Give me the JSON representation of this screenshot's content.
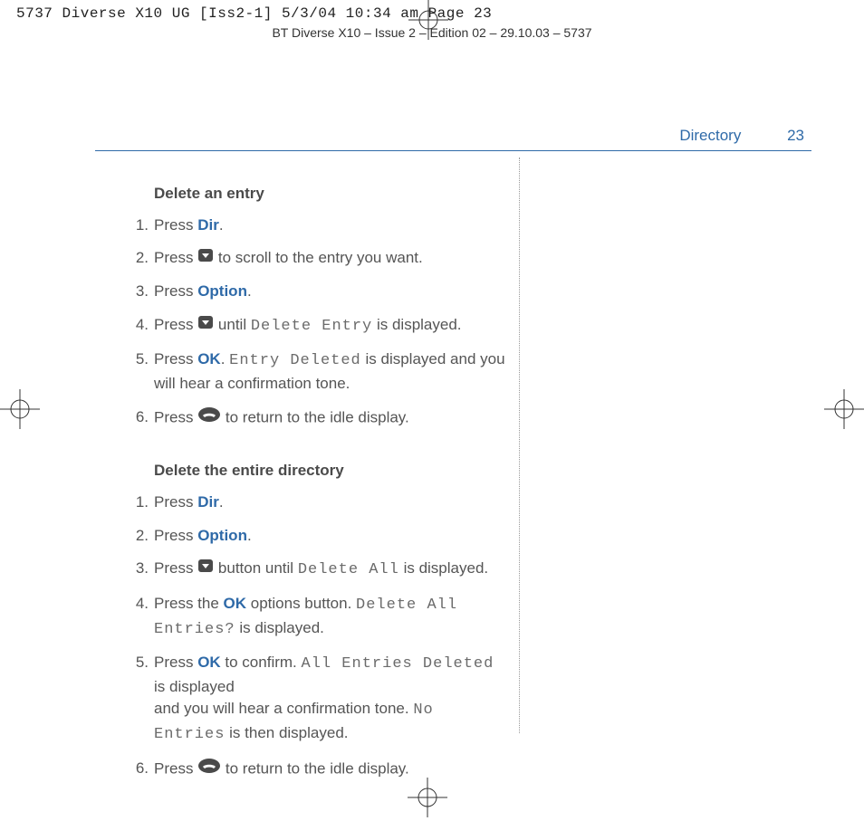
{
  "preflight": "5737 Diverse X10 UG [Iss2-1]  5/3/04  10:34 am  Page 23",
  "issue_line": "BT Diverse X10 – Issue 2 – Edition 02 – 29.10.03 – 5737",
  "running_head": {
    "section": "Directory",
    "page": "23"
  },
  "section1": {
    "title": "Delete an entry",
    "steps": [
      {
        "n": "1.",
        "pre": "Press ",
        "key": "Dir",
        "post": "."
      },
      {
        "n": "2.",
        "pre": "Press ",
        "icon": "down",
        "post": " to scroll to the entry you want."
      },
      {
        "n": "3.",
        "pre": "Press ",
        "key": "Option",
        "post": "."
      },
      {
        "n": "4.",
        "pre": "Press ",
        "icon": "down",
        "mid": " until ",
        "lcd": "Delete Entry",
        "post": " is displayed."
      },
      {
        "n": "5.",
        "pre": "Press ",
        "key": "OK",
        "mid": ". ",
        "lcd": "Entry Deleted",
        "post": " is displayed and you will hear a confirmation tone."
      },
      {
        "n": "6.",
        "pre": "Press ",
        "icon": "end",
        "post": " to return to the idle display."
      }
    ]
  },
  "section2": {
    "title": "Delete the entire directory",
    "steps": [
      {
        "n": "1.",
        "pre": "Press ",
        "key": "Dir",
        "post": "."
      },
      {
        "n": "2.",
        "pre": "Press ",
        "key": "Option",
        "post": "."
      },
      {
        "n": "3.",
        "pre": "Press ",
        "icon": "down",
        "mid": " button until ",
        "lcd": "Delete All",
        "post": " is displayed."
      },
      {
        "n": "4.",
        "pre": "Press the ",
        "key": "OK",
        "mid": " options button. ",
        "lcd": "Delete All Entries?",
        "post": " is displayed."
      },
      {
        "n": "5.",
        "pre": "Press ",
        "key": "OK",
        "mid": " to confirm. ",
        "lcd": "All Entries Deleted",
        "post": " is displayed",
        "post2_pre": "and you will hear a confirmation tone. ",
        "lcd2": "No Entries",
        "post2": " is then displayed."
      },
      {
        "n": "6.",
        "pre": "Press ",
        "icon": "end",
        "post": " to return to the idle display."
      }
    ]
  }
}
